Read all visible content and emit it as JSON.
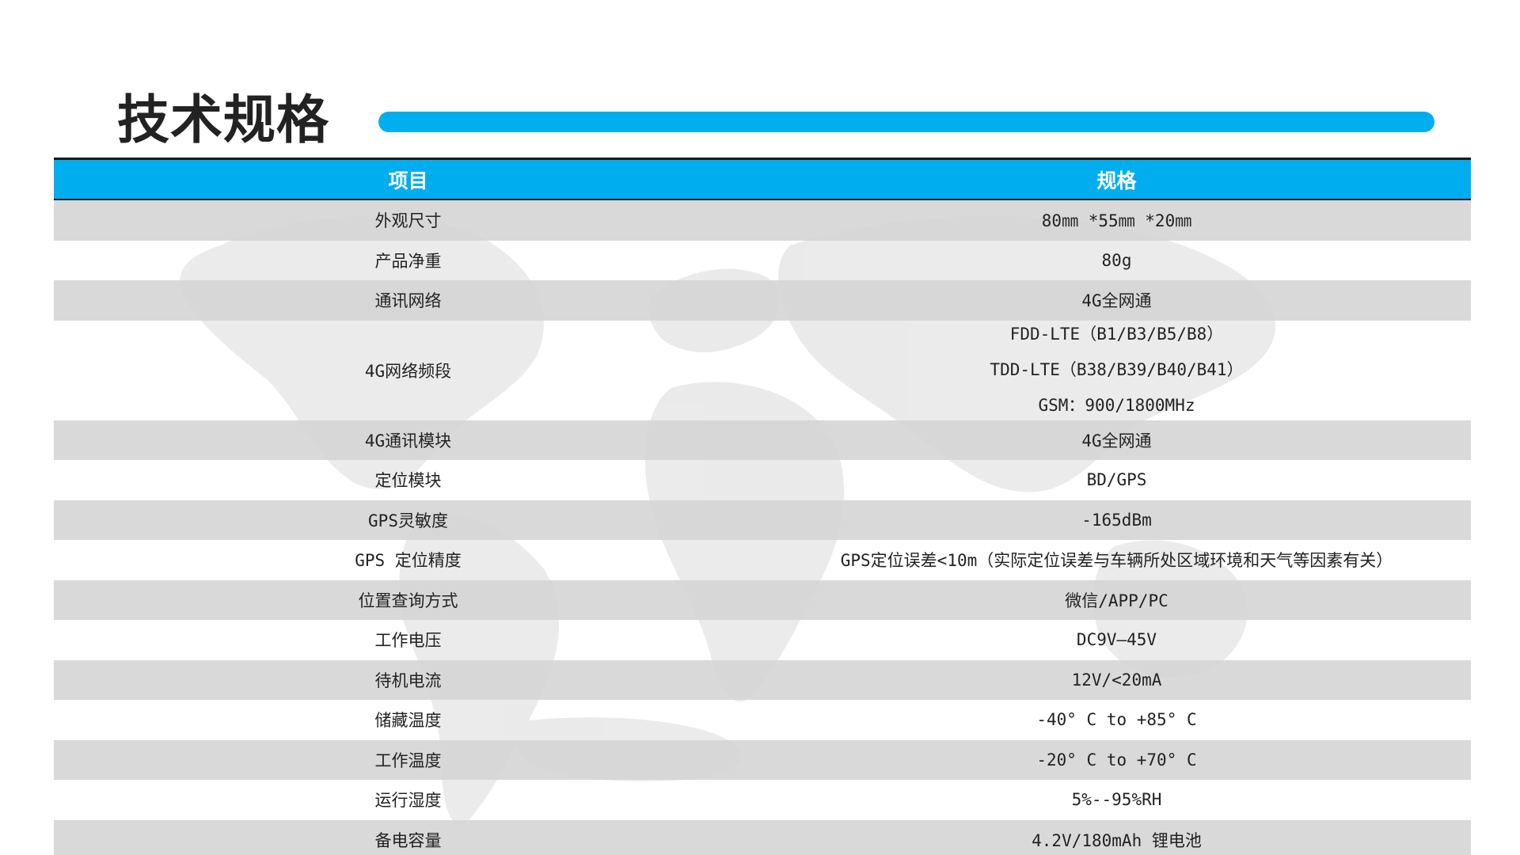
{
  "page_title": "技术规格",
  "colors": {
    "accent": "#00AEEF",
    "row_shade": "#D4D4D4",
    "text": "#222222"
  },
  "table": {
    "headers": [
      "项目",
      "规格"
    ],
    "rows": [
      {
        "item": "外观尺寸",
        "spec": [
          "80㎜ *55㎜ *20㎜"
        ]
      },
      {
        "item": "产品净重",
        "spec": [
          "80g"
        ]
      },
      {
        "item": "通讯网络",
        "spec": [
          "4G全网通"
        ]
      },
      {
        "item": "4G网络频段",
        "spec": [
          "FDD-LTE（B1/B3/B5/B8）",
          "TDD-LTE（B38/B39/B40/B41）",
          "GSM：900/1800MHz"
        ]
      },
      {
        "item": "4G通讯模块",
        "spec": [
          "4G全网通"
        ]
      },
      {
        "item": "定位模块",
        "spec": [
          "BD/GPS"
        ]
      },
      {
        "item": "GPS灵敏度",
        "spec": [
          "-165dBm"
        ]
      },
      {
        "item": "GPS 定位精度",
        "spec": [
          "GPS定位误差<10m（实际定位误差与车辆所处区域环境和天气等因素有关）"
        ]
      },
      {
        "item": "位置查询方式",
        "spec": [
          "微信/APP/PC"
        ]
      },
      {
        "item": "工作电压",
        "spec": [
          "DC9V—45V"
        ]
      },
      {
        "item": "待机电流",
        "spec": [
          "12V/<20mA"
        ]
      },
      {
        "item": "储藏温度",
        "spec": [
          "-40° C to +85° C"
        ]
      },
      {
        "item": "工作温度",
        "spec": [
          "-20° C to +70° C"
        ]
      },
      {
        "item": "运行湿度",
        "spec": [
          "5%--95%RH"
        ]
      },
      {
        "item": "备电容量",
        "spec": [
          "4.2V/180mAh 锂电池"
        ]
      }
    ]
  }
}
